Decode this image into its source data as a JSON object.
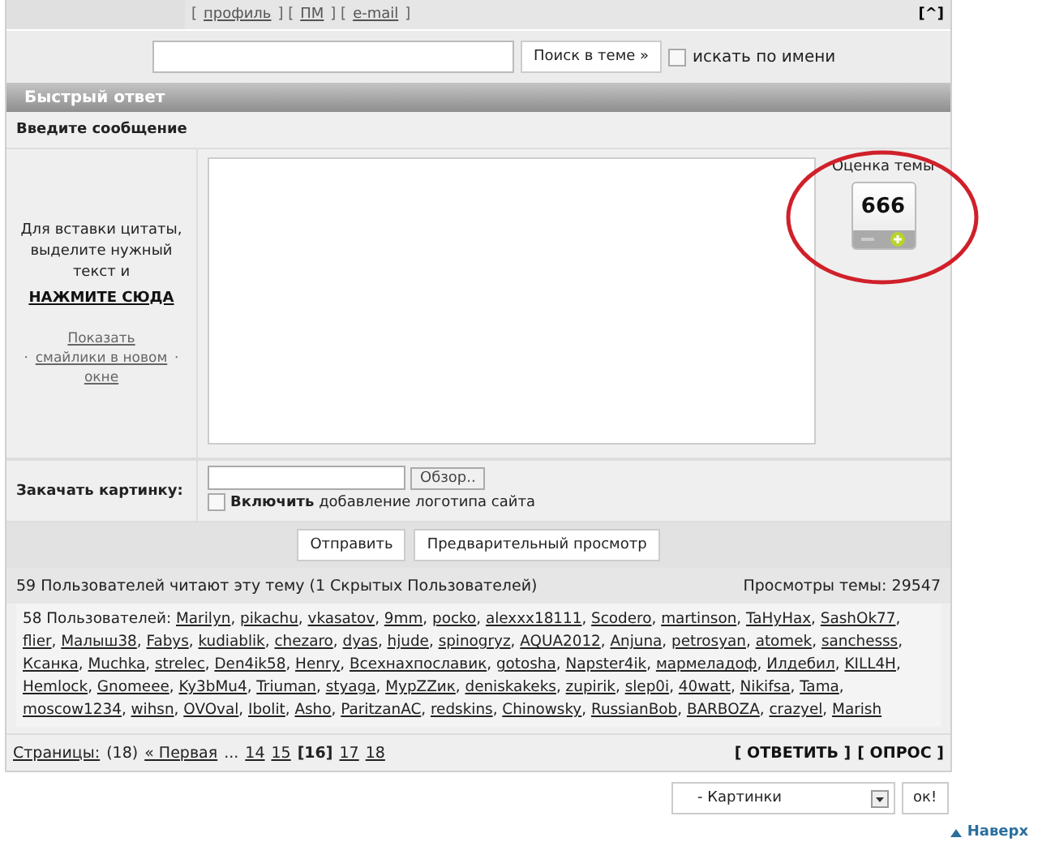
{
  "top_bar": {
    "segments": [
      {
        "kind": "text",
        "text": "["
      },
      {
        "kind": "link",
        "text": "профиль"
      },
      {
        "kind": "text",
        "text": "] ["
      },
      {
        "kind": "link",
        "text": "ПМ"
      },
      {
        "kind": "text",
        "text": "] ["
      },
      {
        "kind": "link",
        "text": "e-mail"
      },
      {
        "kind": "text",
        "text": "]"
      }
    ],
    "top_button": "[^]"
  },
  "search": {
    "button": "Поиск в теме »",
    "by_name": {
      "label": "искать по имени",
      "checked": false
    }
  },
  "quick_reply": {
    "title": "Быстрый ответ",
    "subtitle": "Введите сообщение",
    "hint": "Для вставки цитаты, выделите нужный текст и",
    "quote_link": "НАЖМИТЕ СЮДА",
    "smilies": {
      "before": "·",
      "link": "Показать смайлики в новом окне",
      "after": "·"
    },
    "rating": {
      "label": "Оценка темы",
      "value": "666"
    },
    "upload": {
      "label": "Закачать картинку:",
      "browse": "Обзор..",
      "logo": {
        "label": "**Включить** добавление логотипа сайта",
        "checked": false
      }
    },
    "buttons": [
      "Отправить",
      "Предварительный просмотр"
    ]
  },
  "readers": {
    "summary": "59 Пользователей читают эту тему (1 Скрытых Пользователей)",
    "views": "Просмотры темы: 29547",
    "users_label": "58 Пользователей:",
    "users": [
      "Marilyn",
      "pikachu",
      "vkasatov",
      "9mm",
      "pocko",
      "alexxx18111",
      "Scodero",
      "martinson",
      "TaHyHax",
      "SashOk77",
      "flier",
      "Малыш38",
      "Fabys",
      "kudiablik",
      "chezaro",
      "dyas",
      "hjude",
      "spinogryz",
      "AQUA2012",
      "Anjuna",
      "petrosyan",
      "atomek",
      "sanchesss",
      "Ксанка",
      "Muchka",
      "strelec",
      "Den4ik58",
      "Henry",
      "Всехнахпославик",
      "gotosha",
      "Napster4ik",
      "мармеладоф",
      "Илдебил",
      "KILL4H",
      "Hemlock",
      "Gnomeee",
      "Ky3bMu4",
      "Triuman",
      "styaga",
      "MypZZик",
      "deniskakeks",
      "zupirik",
      "slep0i",
      "40watt",
      "Nikifsa",
      "Tama",
      "moscow1234",
      "wihsn",
      "OVOval",
      "Ibolit",
      "Asho",
      "ParitzanAC",
      "redskins",
      "Chinowsky",
      "RussianBob",
      "BARBOZA",
      "crazyel",
      "Marish"
    ],
    "separator": ","
  },
  "pages": {
    "label": "Страницы:",
    "count": "(18)",
    "first": "« Первая",
    "gap": "...",
    "items": [
      {
        "label": "14",
        "selected": false
      },
      {
        "label": "15",
        "selected": false
      },
      {
        "label": "[16]",
        "selected": true
      },
      {
        "label": "17",
        "selected": false
      },
      {
        "label": "18",
        "selected": false
      }
    ],
    "actions": [
      "[ ОТВЕТИТЬ ]",
      "[ ОПРОС ]"
    ]
  },
  "jump": {
    "value": "- Картинки",
    "button": "ок!"
  },
  "to_top": "Наверх"
}
